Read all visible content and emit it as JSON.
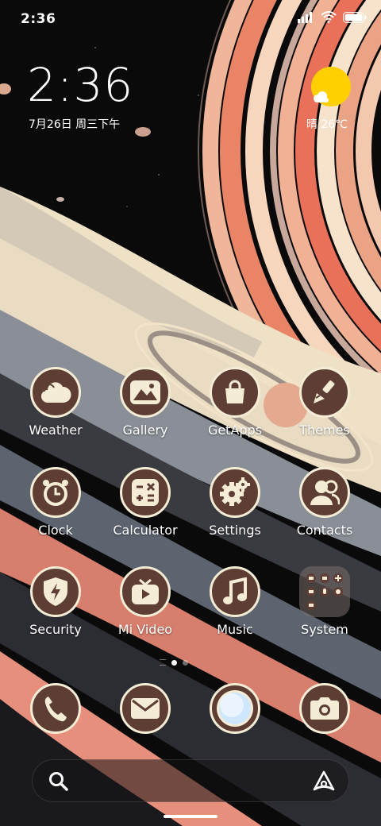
{
  "status": {
    "time": "2:36"
  },
  "widget": {
    "clock": "2:36",
    "date": "7月26日 周三下午",
    "weather": "晴 26℃"
  },
  "apps": [
    {
      "label": "Weather",
      "icon": "cloud-icon"
    },
    {
      "label": "Gallery",
      "icon": "mountain-icon"
    },
    {
      "label": "GetApps",
      "icon": "shopping-bag-icon"
    },
    {
      "label": "Themes",
      "icon": "paintbrush-icon"
    },
    {
      "label": "Clock",
      "icon": "alarm-clock-icon"
    },
    {
      "label": "Calculator",
      "icon": "calculator-icon"
    },
    {
      "label": "Settings",
      "icon": "gear-icon"
    },
    {
      "label": "Contacts",
      "icon": "people-icon"
    },
    {
      "label": "Security",
      "icon": "shield-bolt-icon"
    },
    {
      "label": "Mi Video",
      "icon": "tv-play-icon"
    },
    {
      "label": "Music",
      "icon": "music-note-icon"
    },
    {
      "label": "System",
      "icon": "folder-icon"
    }
  ],
  "dock": [
    {
      "name": "phone",
      "icon": "phone-icon"
    },
    {
      "name": "messages",
      "icon": "envelope-icon"
    },
    {
      "name": "browser",
      "icon": "globe-icon"
    },
    {
      "name": "camera",
      "icon": "camera-icon"
    }
  ],
  "pages": {
    "count": 2,
    "current": 1
  },
  "colors": {
    "icon_bg": "#5e3e34",
    "icon_glyph": "#f5ecd6",
    "sun": "#ffd000"
  }
}
